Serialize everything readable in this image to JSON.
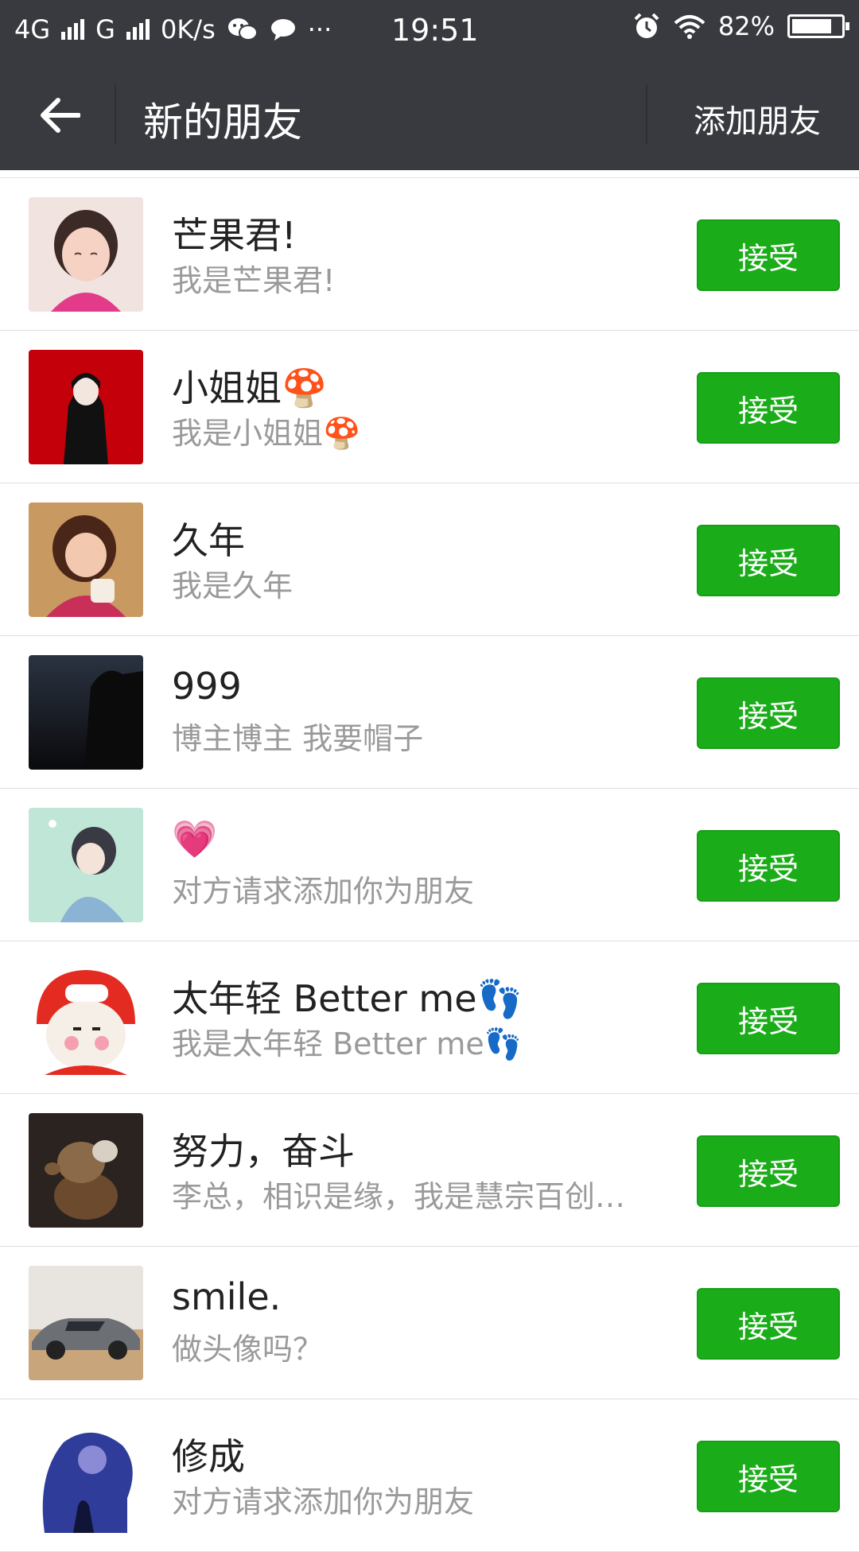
{
  "status_bar": {
    "network_1": "4G",
    "network_2": "G",
    "speed": "0K/s",
    "more": "···",
    "time": "19:51",
    "battery": "82%",
    "battery_level": 0.82,
    "icons": [
      "signal-icon",
      "wechat-icon",
      "chat-bubble-icon",
      "alarm-icon",
      "wifi-icon",
      "battery-icon"
    ]
  },
  "nav": {
    "title": "新的朋友",
    "add_friend": "添加朋友",
    "back_icon": "back-arrow-icon"
  },
  "colors": {
    "header_bg": "#393a3f",
    "accept_bg": "#1aad19"
  },
  "requests": [
    {
      "name": "芒果君!",
      "message": "我是芒果君!",
      "button": "接受",
      "avatar": "girl-photo-avatar"
    },
    {
      "name": "小姐姐🍄",
      "message": "我是小姐姐🍄",
      "button": "接受",
      "avatar": "illustrated-girl-avatar"
    },
    {
      "name": "久年",
      "message": "我是久年",
      "button": "接受",
      "avatar": "child-photo-avatar"
    },
    {
      "name": "999",
      "message": "博主博主 我要帽子",
      "button": "接受",
      "avatar": "dark-landscape-avatar"
    },
    {
      "name": "💗",
      "message": "对方请求添加你为朋友",
      "button": "接受",
      "avatar": "anime-boy-avatar"
    },
    {
      "name": "太年轻 Better me👣",
      "message": "我是太年轻 Better me👣",
      "button": "接受",
      "avatar": "cartoon-helmet-avatar"
    },
    {
      "name": "努力，奋斗",
      "message": "李总，相识是缘，我是慧宗百创…",
      "button": "接受",
      "avatar": "statue-avatar"
    },
    {
      "name": "smile.",
      "message": "做头像吗？",
      "button": "接受",
      "avatar": "car-avatar"
    },
    {
      "name": "修成",
      "message": "对方请求添加你为朋友",
      "button": "接受",
      "avatar": "silhouette-art-avatar"
    }
  ]
}
